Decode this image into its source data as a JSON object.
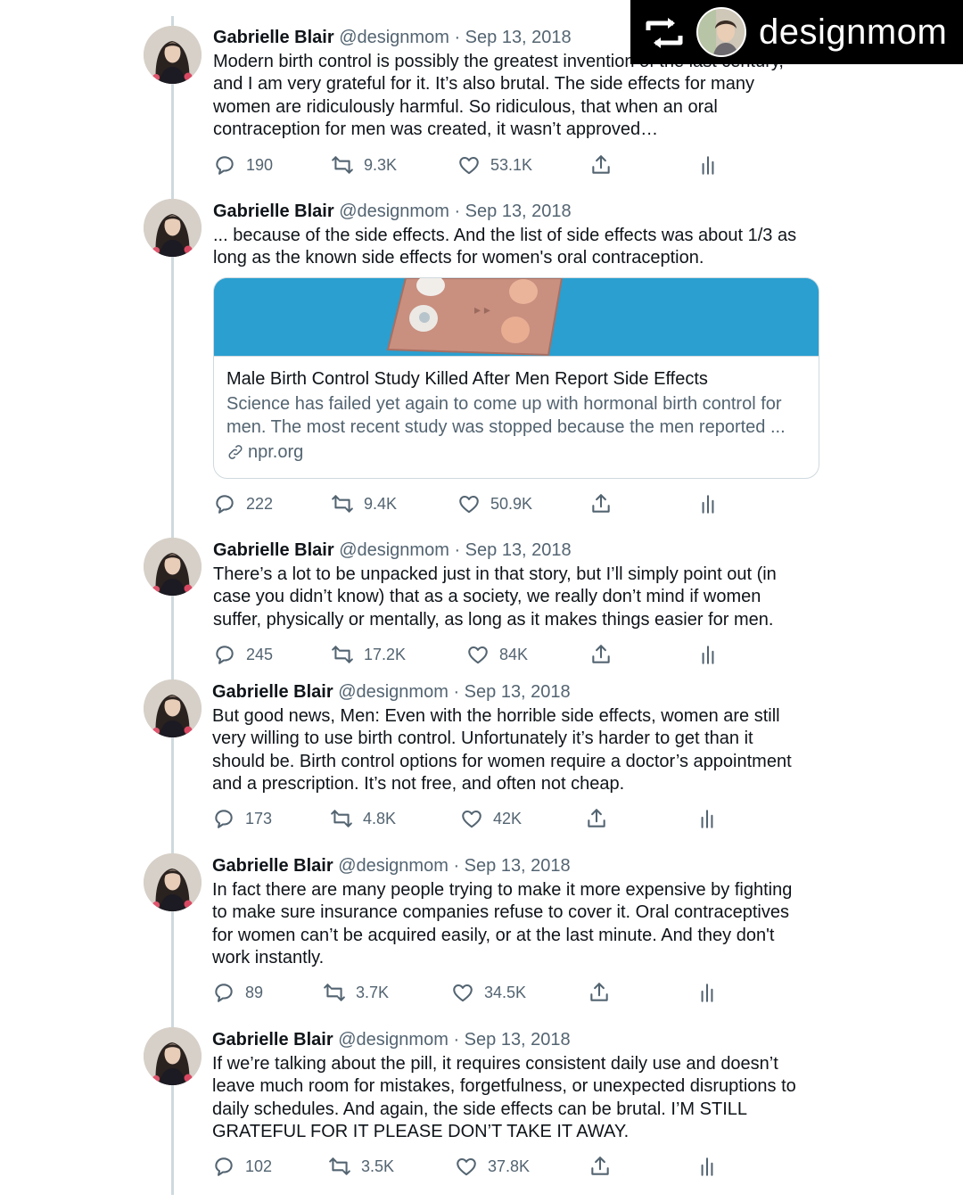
{
  "repost": {
    "label": "designmom",
    "icon": "repost-icon"
  },
  "tweets": [
    {
      "name": "Gabrielle Blair",
      "handle": "@designmom",
      "sep": "·",
      "date": "Sep 13, 2018",
      "lines": [
        "Modern birth control is possibly the greatest invention of the last century,",
        "and I am very grateful for it. It’s also brutal. The side effects for many",
        "women are ridiculously harmful. So ridiculous, that when an oral",
        "contraception for men was created, it wasn’t approved…"
      ],
      "replies": "190",
      "retweets": "9.3K",
      "likes": "53.1K"
    },
    {
      "name": "Gabrielle Blair",
      "handle": "@designmom",
      "sep": "·",
      "date": "Sep 13, 2018",
      "lines": [
        "... because of the side effects. And the list of side effects was about 1/3 as",
        "long as the known side effects for women's oral contraception."
      ],
      "card": {
        "title": "Male Birth Control Study Killed After Men Report Side Effects",
        "desc1": "Science has failed yet again to come up with hormonal birth control for",
        "desc2": "men. The most recent study was stopped because the men reported ...",
        "domain": "npr.org"
      },
      "replies": "222",
      "retweets": "9.4K",
      "likes": "50.9K"
    },
    {
      "name": "Gabrielle Blair",
      "handle": "@designmom",
      "sep": "·",
      "date": "Sep 13, 2018",
      "lines": [
        "There’s a lot to be unpacked just in that story, but I’ll simply point out (in",
        "case you didn’t know) that as a society, we really don’t mind if women",
        "suffer, physically or mentally, as long as it makes things easier for men."
      ],
      "replies": "245",
      "retweets": "17.2K",
      "likes": "84K"
    },
    {
      "name": "Gabrielle Blair",
      "handle": "@designmom",
      "sep": "·",
      "date": "Sep 13, 2018",
      "lines": [
        "But good news, Men: Even with the horrible side effects, women are still",
        "very willing to use birth control. Unfortunately it’s harder to get than it",
        "should be. Birth control options for women require a doctor’s appointment",
        "and a prescription. It’s not free, and often not cheap."
      ],
      "replies": "173",
      "retweets": "4.8K",
      "likes": "42K"
    },
    {
      "name": "Gabrielle Blair",
      "handle": "@designmom",
      "sep": "·",
      "date": "Sep 13, 2018",
      "lines": [
        "In fact there are many people trying to make it more expensive by fighting",
        "to make sure insurance companies refuse to cover it. Oral contraceptives",
        "for women can’t be acquired easily, or at the last minute. And they don't",
        "work instantly."
      ],
      "replies": "89",
      "retweets": "3.7K",
      "likes": "34.5K"
    },
    {
      "name": "Gabrielle Blair",
      "handle": "@designmom",
      "sep": "·",
      "date": "Sep 13, 2018",
      "lines": [
        "If we’re talking about the pill, it requires consistent daily use and doesn’t",
        "leave much room for mistakes, forgetfulness, or unexpected disruptions to",
        "daily schedules. And again, the side effects can be brutal. I’M STILL",
        "GRATEFUL FOR IT PLEASE DON’T TAKE IT AWAY."
      ],
      "replies": "102",
      "retweets": "3.5K",
      "likes": "37.8K"
    }
  ]
}
